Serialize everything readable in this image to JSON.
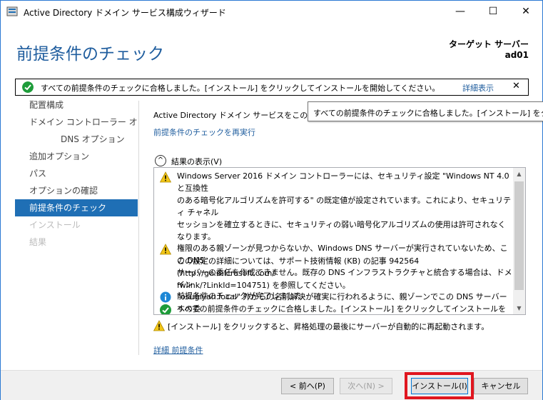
{
  "window": {
    "title": "Active Directory ドメイン サービス構成ウィザード",
    "controls": {
      "minimize": "—",
      "maximize": "☐",
      "close": "✕"
    }
  },
  "header": {
    "page_title": "前提条件のチェック",
    "target_label": "ターゲット サーバー",
    "target_value": "ad01"
  },
  "notification": {
    "icon": "check-circle-icon",
    "message": "すべての前提条件のチェックに合格しました。[インストール] をクリックしてインストールを開始してください。",
    "details_link": "詳細表示",
    "close": "✕"
  },
  "sidebar": {
    "items": [
      {
        "label": "配置構成",
        "state": "normal"
      },
      {
        "label": "ドメイン コントローラー オプシ...",
        "state": "normal"
      },
      {
        "label": "DNS オプション",
        "state": "normal",
        "sub": true
      },
      {
        "label": "追加オプション",
        "state": "normal"
      },
      {
        "label": "パス",
        "state": "normal"
      },
      {
        "label": "オプションの確認",
        "state": "normal"
      },
      {
        "label": "前提条件のチェック",
        "state": "active"
      },
      {
        "label": "インストール",
        "state": "disabled"
      },
      {
        "label": "結果",
        "state": "disabled"
      }
    ]
  },
  "content": {
    "intro_text": "Active Directory ドメイン サービスをこのコンピ",
    "tooltip": "すべての前提条件のチェックに合格しました。[インストール] をクリックしてインストールを開始してください。",
    "rerun_link": "前提条件のチェックを再実行",
    "results_toggle_label": "結果の表示(V)",
    "results": [
      {
        "icon": "warning-icon",
        "text": "Windows Server 2016 ドメイン コントローラーには、セキュリティ設定 \"Windows NT 4.0 と互換性\nのある暗号化アルゴリズムを許可する\" の既定値が設定されています。これにより、セキュリティ チャネル\nセッションを確立するときに、セキュリティの弱い暗号化アルゴリズムの使用は許可されなくなります。\n\nこの設定の詳細については、サポート技術情報 (KB) の記事 942564 (http://go.microsoft.com/\nfwlink/?LinkId=104751) を参照してください。"
      },
      {
        "icon": "warning-icon",
        "text": "権限のある親ゾーンが見つからないか、Windows DNS サーバーが実行されていないため、この DNS\nサーバーの委任を作成できません。既存の DNS インフラストラクチャと統合する場合は、ドメイン\n\"osugiyan.local\" 外からの名前解決が確実に行われるように、親ゾーンでこの DNS サーバーへの委\n任を手動で作成する必要があります。それ以外の場合は、何もする必要はありません。"
      },
      {
        "icon": "info-icon",
        "text": "前提条件のチェックが完了しました"
      },
      {
        "icon": "check-circle-icon",
        "text": "すべての前提条件のチェックに合格しました。[インストール] をクリックしてインストールを開始してくださ"
      }
    ],
    "restart_warning": "[インストール] をクリックすると、昇格処理の最後にサーバーが自動的に再起動されます。",
    "more_link": "詳細 前提条件"
  },
  "footer": {
    "back_label": "< 前へ(P)",
    "next_label": "次へ(N) >",
    "install_label": "インストール(I)",
    "cancel_label": "キャンセル"
  },
  "colors": {
    "accent": "#1f6fb5",
    "title": "#1f5d9e",
    "success": "#1e9c3a",
    "warning": "#f2c618",
    "info": "#1e88d6",
    "highlight": "#e0161f"
  }
}
